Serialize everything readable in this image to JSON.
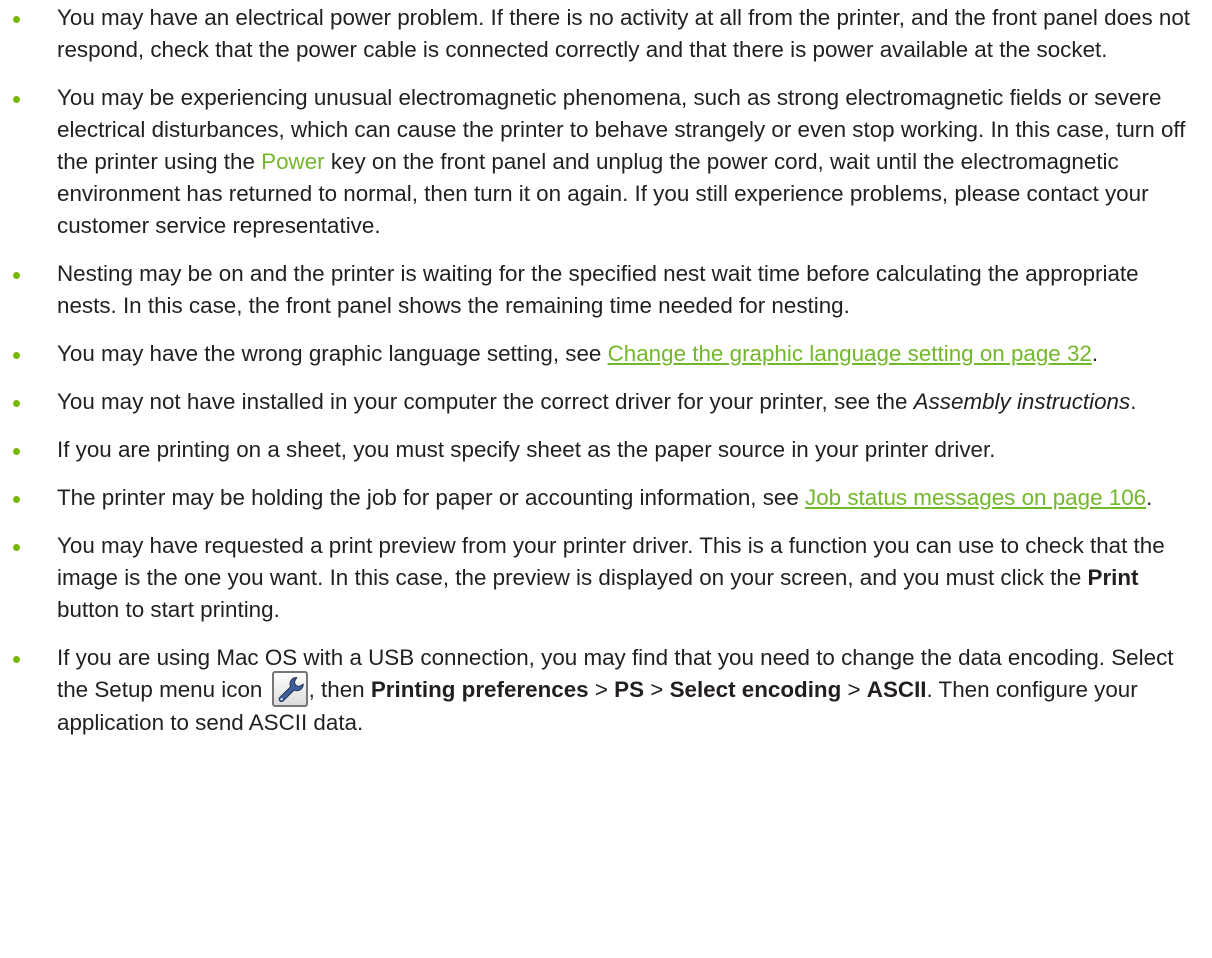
{
  "bullets": [
    {
      "text": "You may have an electrical power problem. If there is no activity at all from the printer, and the front panel does not respond, check that the power cable is connected correctly and that there is power available at the socket."
    },
    {
      "part1": "You may be experiencing unusual electromagnetic phenomena, such as strong electromagnetic fields or severe electrical disturbances, which can cause the printer to behave strangely or even stop working. In this case, turn off the printer using the ",
      "key": "Power",
      "part2": " key on the front panel and unplug the power cord, wait until the electromagnetic environment has returned to normal, then turn it on again. If you still experience problems, please contact your customer service representative."
    },
    {
      "text": "Nesting may be on and the printer is waiting for the specified nest wait time before calculating the appropriate nests. In this case, the front panel shows the remaining time needed for nesting."
    },
    {
      "part1": "You may have the wrong graphic language setting, see ",
      "link": "Change the graphic language setting on page 32",
      "part2": "."
    },
    {
      "part1": "You may not have installed in your computer the correct driver for your printer, see the ",
      "emph": "Assembly instructions",
      "part2": "."
    },
    {
      "text": "If you are printing on a sheet, you must specify sheet as the paper source in your printer driver."
    },
    {
      "part1": "The printer may be holding the job for paper or accounting information, see ",
      "link": "Job status messages on page 106",
      "part2": "."
    },
    {
      "part1": "You may have requested a print preview from your printer driver. This is a function you can use to check that the image is the one you want. In this case, the preview is displayed on your screen, and you must click the ",
      "button": "Print",
      "part2": " button to start printing."
    },
    {
      "part1": "If you are using Mac OS with a USB connection, you may find that you need to change the data encoding. Select the Setup menu icon ",
      "icon": "wrench-icon",
      "part2": ", then ",
      "step1": "Printing preferences",
      "sep1": " > ",
      "step2": "PS",
      "sep2": "  > ",
      "step3": "Select encoding",
      "sep3": " > ",
      "step4": "ASCII",
      "part3": ". Then configure your application to send ASCII data."
    }
  ],
  "colors": {
    "bullet": "#7ab800",
    "link": "#73b72b",
    "text": "#231f20"
  }
}
